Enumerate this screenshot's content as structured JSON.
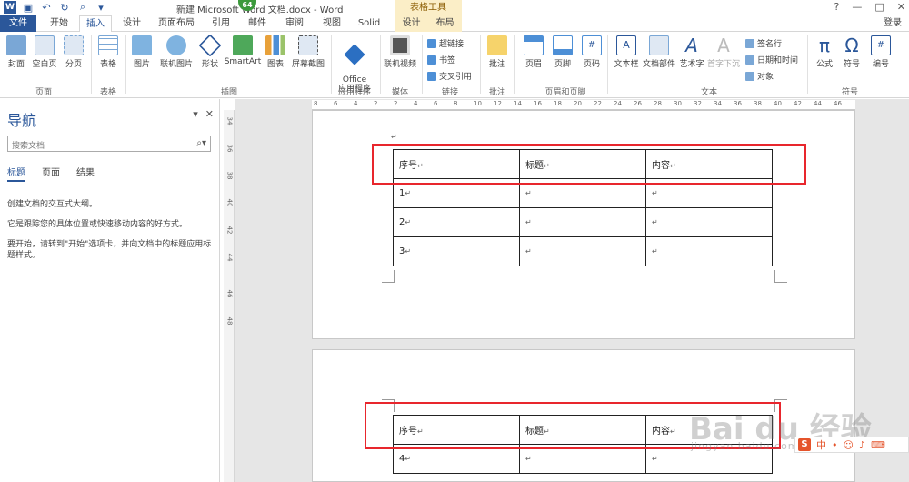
{
  "titlebar": {
    "doc_title": "新建 Microsoft Word 文档.docx - Word",
    "context_group": "表格工具",
    "badge": "64",
    "window_controls": [
      "?",
      "—",
      "□",
      "✕"
    ]
  },
  "tabs": [
    "文件",
    "开始",
    "插入",
    "设计",
    "页面布局",
    "引用",
    "邮件",
    "审阅",
    "视图",
    "Solid",
    "设计",
    "布局"
  ],
  "user": "登录",
  "ribbon": {
    "pages": {
      "cover": "封面",
      "blank": "空白页",
      "break": "分页",
      "label": "页面"
    },
    "tables": {
      "table": "表格",
      "label": "表格"
    },
    "illustrations": {
      "picture": "图片",
      "online_picture": "联机图片",
      "shapes": "形状",
      "smartart": "SmartArt",
      "chart": "图表",
      "screenshot": "屏幕截图",
      "label": "插图"
    },
    "apps": {
      "office": "Office\n应用程序",
      "label": "应用程序"
    },
    "media": {
      "online_video": "联机视频",
      "label": "媒体"
    },
    "links": {
      "hyperlink": "超链接",
      "bookmark": "书签",
      "crossref": "交叉引用",
      "label": "链接"
    },
    "comments": {
      "comment": "批注",
      "label": "批注"
    },
    "header_footer": {
      "header": "页眉",
      "footer": "页脚",
      "page_number": "页码",
      "label": "页眉和页脚"
    },
    "text": {
      "textbox": "文本框",
      "quickparts": "文档部件",
      "wordart": "艺术字",
      "dropcap": "首字下沉",
      "signature": "签名行",
      "datetime": "日期和时间",
      "object": "对象",
      "label": "文本"
    },
    "symbols": {
      "equation": "公式",
      "symbol": "符号",
      "number": "编号",
      "label": "符号"
    }
  },
  "nav": {
    "title": "导航",
    "search_placeholder": "搜索文档",
    "tabs": [
      "标题",
      "页面",
      "结果"
    ],
    "line1": "创建文档的交互式大纲。",
    "line2": "它是跟踪您的具体位置或快速移动内容的好方式。",
    "line3": "要开始，请转到\"开始\"选项卡，并向文档中的标题应用标题样式。"
  },
  "ruler": {
    "h_ticks": [
      "8",
      "6",
      "4",
      "2",
      "2",
      "4",
      "6",
      "8",
      "10",
      "12",
      "14",
      "16",
      "18",
      "20",
      "22",
      "24",
      "26",
      "28",
      "30",
      "32",
      "34",
      "36",
      "38",
      "40",
      "42",
      "44",
      "46"
    ],
    "v_ticks": [
      "34",
      "36",
      "38",
      "40",
      "42",
      "44",
      "46",
      "48"
    ]
  },
  "table1": {
    "header": [
      "序号",
      "标题",
      "内容"
    ],
    "rows": [
      [
        "1",
        "",
        ""
      ],
      [
        "2",
        "",
        ""
      ],
      [
        "3",
        "",
        ""
      ]
    ]
  },
  "table2": {
    "header": [
      "序号",
      "标题",
      "内容"
    ],
    "rows": [
      [
        "4",
        "",
        ""
      ]
    ]
  },
  "para_mark": "↵",
  "watermark": {
    "main": "Bai du 经验",
    "sub": "jingyan.baidu.com"
  },
  "ime": {
    "brand": "S",
    "lang": "中"
  },
  "colors": {
    "accent": "#2b579a",
    "highlight": "#e8262d",
    "context_tab": "#fbeec7"
  }
}
